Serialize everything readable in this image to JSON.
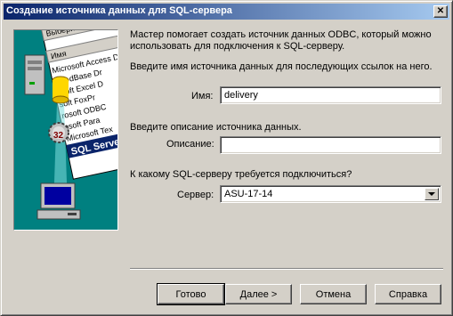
{
  "window": {
    "title": "Создание источника данных для SQL-сервера",
    "close_glyph": "✕"
  },
  "intro": {
    "line1": "Мастер помогает создать источник данных ODBC, который можно",
    "line2": "использовать для подключения к SQL-серверу."
  },
  "name_section": {
    "prompt": "Введите имя источника данных для последующих ссылок на него.",
    "label": "Имя:",
    "value": "delivery"
  },
  "description_section": {
    "prompt": "Введите описание источника данных.",
    "label": "Описание:",
    "value": ""
  },
  "server_section": {
    "prompt": "К какому SQL-серверу требуется подключиться?",
    "label": "Сервер:",
    "value": "ASU-17-14"
  },
  "illustration": {
    "header": "Выберите драй",
    "column": "Имя",
    "drivers": [
      "Microsoft Access D",
      "soft dBase Dr",
      "osoft Excel D",
      "soft FoxPr",
      "rosoft ODBC",
      "osoft Para",
      "Microsoft Tex"
    ],
    "selected": "SQL Serve",
    "badge": "32"
  },
  "buttons": {
    "finish": "Готово",
    "next": "Далее >",
    "cancel": "Отмена",
    "help": "Справка"
  }
}
